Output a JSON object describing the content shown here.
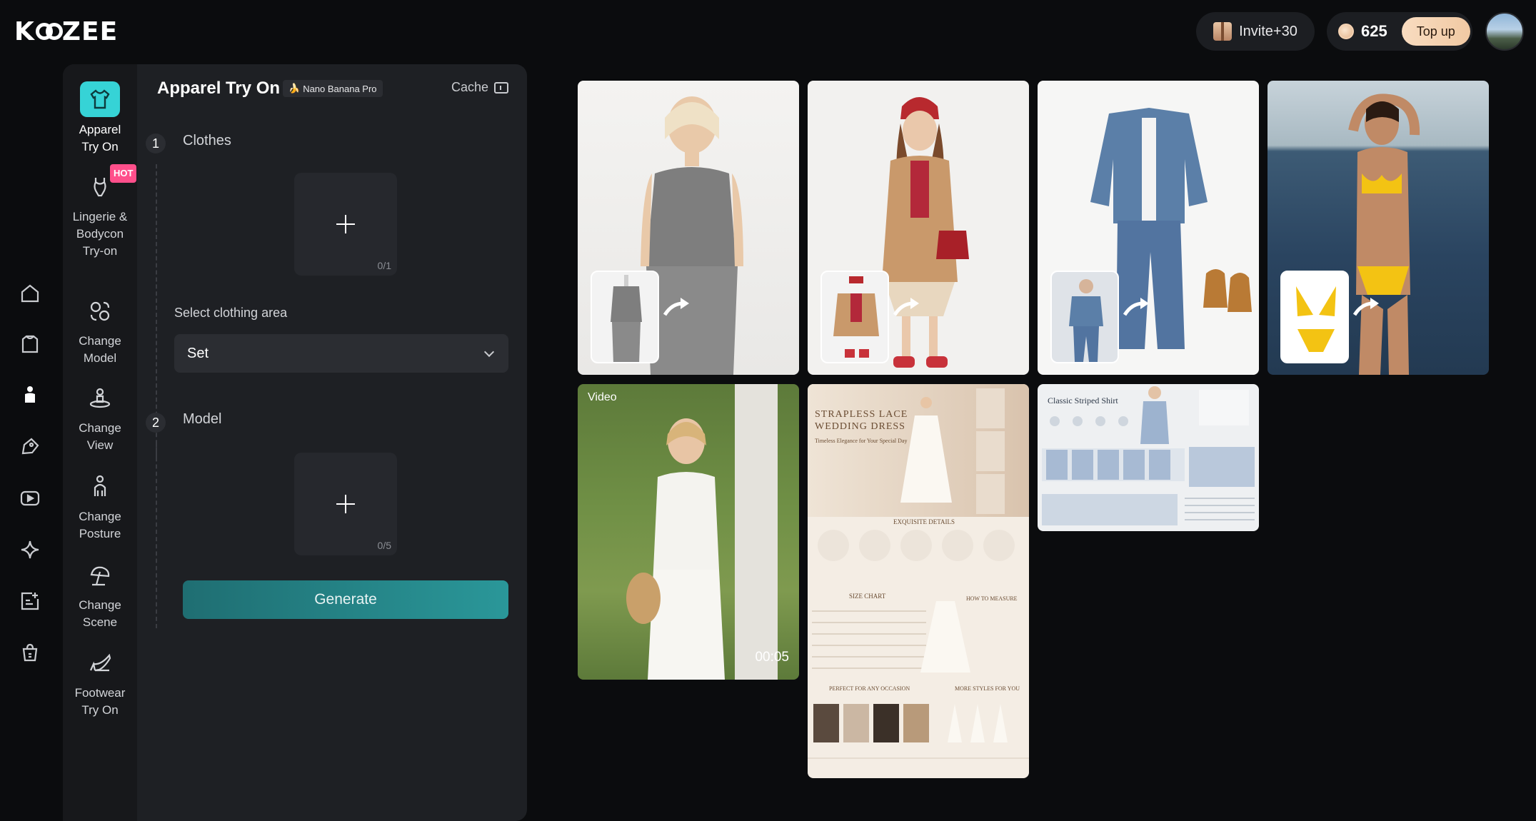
{
  "app": {
    "logo": "KOOZEE"
  },
  "header": {
    "invite_label": "Invite+30",
    "credits": "625",
    "topup_label": "Top up"
  },
  "nav_icons": [
    "home-icon",
    "store-icon",
    "person-icon",
    "tag-icon",
    "video-icon",
    "sparkle-icon",
    "add-image-icon",
    "shopping-bag-icon"
  ],
  "tools": [
    {
      "label": "Apparel Try On",
      "icon": "tshirt-icon",
      "active": true
    },
    {
      "label": "Lingerie & Bodycon Try-on",
      "icon": "bodysuit-icon",
      "badge": "HOT"
    },
    {
      "label": "Change Model",
      "icon": "swap-face-icon"
    },
    {
      "label": "Change View",
      "icon": "rotate-person-icon"
    },
    {
      "label": "Change Posture",
      "icon": "posture-icon"
    },
    {
      "label": "Change Scene",
      "icon": "umbrella-icon"
    },
    {
      "label": "Footwear Try On",
      "icon": "heel-shoe-icon"
    }
  ],
  "form": {
    "title": "Apparel Try On",
    "model_badge": "Nano Banana Pro",
    "cache_label": "Cache",
    "step1": {
      "num": "1",
      "label": "Clothes",
      "count": "0/1"
    },
    "select_label": "Select clothing area",
    "select_value": "Set",
    "step2": {
      "num": "2",
      "label": "Model",
      "count": "0/5"
    },
    "generate_label": "Generate"
  },
  "gallery": {
    "video_tag": "Video",
    "video_duration": "00:05",
    "doc1": {
      "title": "STRAPLESS LACE WEDDING DRESS",
      "subtitle": "Timeless Elegance for Your Special Day",
      "section1": "EXQUISITE DETAILS",
      "section2": "SIZE CHART",
      "section3": "HOW TO MEASURE",
      "section4": "PERFECT FOR ANY OCCASION",
      "section5": "MORE STYLES FOR YOU"
    },
    "doc2": {
      "title": "Classic Striped Shirt"
    }
  }
}
